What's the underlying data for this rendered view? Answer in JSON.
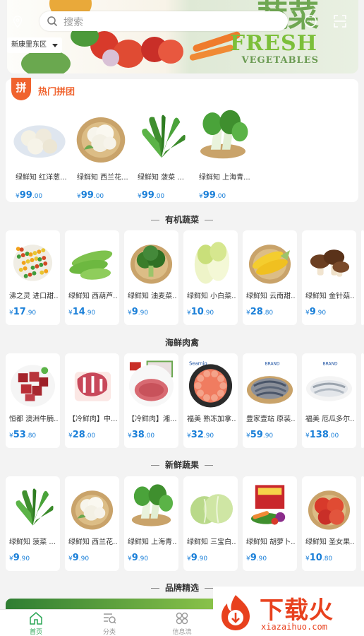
{
  "search": {
    "placeholder": "搜索"
  },
  "location": {
    "district": "新康里东区"
  },
  "banner": {
    "title_cn": "蔬菜",
    "title_en": "FRESH",
    "subtitle_en": "VEGETABLES"
  },
  "group_buy": {
    "badge": "拼",
    "title": "热门拼团",
    "items": [
      {
        "name": "绿鲜知 红洋葱...",
        "sym": "¥",
        "int": "99",
        "dec": ".00",
        "icon": "onion"
      },
      {
        "name": "绿鲜知 西兰花...",
        "sym": "¥",
        "int": "99",
        "dec": ".00",
        "icon": "cauliflower"
      },
      {
        "name": "绿鲜知 菠菜 ...",
        "sym": "¥",
        "int": "99",
        "dec": ".00",
        "icon": "spinach"
      },
      {
        "name": "绿鲜知 上海青...",
        "sym": "¥",
        "int": "99",
        "dec": ".00",
        "icon": "bokchoy"
      }
    ]
  },
  "sections": [
    {
      "title": "有机蔬菜",
      "items": [
        {
          "name": "沸之灵 进口甜...",
          "sym": "¥",
          "int": "17",
          "dec": ".90",
          "icon": "mixed-veg"
        },
        {
          "name": "绿鲜知 西葫芦...",
          "sym": "¥",
          "int": "14",
          "dec": ".90",
          "icon": "zucchini"
        },
        {
          "name": "绿鲜知 油麦菜...",
          "sym": "¥",
          "int": "9",
          "dec": ".90",
          "icon": "broccoli"
        },
        {
          "name": "绿鲜知 小白菜...",
          "sym": "¥",
          "int": "10",
          "dec": ".90",
          "icon": "cabbage"
        },
        {
          "name": "绿鲜知 云南甜...",
          "sym": "¥",
          "int": "28",
          "dec": ".80",
          "icon": "corn"
        },
        {
          "name": "绿鲜知 金针菇...",
          "sym": "¥",
          "int": "9",
          "dec": ".90",
          "icon": "mushroom"
        }
      ]
    },
    {
      "title": "海鲜肉禽",
      "items": [
        {
          "name": "恒都 澳洲牛腩...",
          "sym": "¥",
          "int": "53",
          "dec": ".80",
          "icon": "beef"
        },
        {
          "name": "【冷鲜肉】中...",
          "sym": "¥",
          "int": "28",
          "dec": ".00",
          "icon": "ribs"
        },
        {
          "name": "【冷鲜肉】湘...",
          "sym": "¥",
          "int": "38",
          "dec": ".00",
          "icon": "mince"
        },
        {
          "name": "福美 熟冻加拿...",
          "sym": "¥",
          "int": "32",
          "dec": ".90",
          "icon": "shrimp-plate"
        },
        {
          "name": "豊家壹站 原装...",
          "sym": "¥",
          "int": "59",
          "dec": ".90",
          "icon": "prawns"
        },
        {
          "name": "福美 厄瓜多尔...",
          "sym": "¥",
          "int": "138",
          "dec": ".00",
          "icon": "white-shrimp"
        }
      ]
    },
    {
      "title": "新鲜蔬果",
      "items": [
        {
          "name": "绿鲜知 菠菜 ...",
          "sym": "¥",
          "int": "9",
          "dec": ".90",
          "icon": "spinach"
        },
        {
          "name": "绿鲜知 西兰花...",
          "sym": "¥",
          "int": "9",
          "dec": ".90",
          "icon": "cauliflower"
        },
        {
          "name": "绿鲜知 上海青...",
          "sym": "¥",
          "int": "9",
          "dec": ".90",
          "icon": "bokchoy"
        },
        {
          "name": "绿鲜知 三宝白...",
          "sym": "¥",
          "int": "9",
          "dec": ".90",
          "icon": "lettuce"
        },
        {
          "name": "绿鲜知 胡萝卜...",
          "sym": "¥",
          "int": "9",
          "dec": ".90",
          "icon": "veg-box"
        },
        {
          "name": "绿鲜知 圣女果...",
          "sym": "¥",
          "int": "10",
          "dec": ".80",
          "icon": "tomato"
        }
      ]
    }
  ],
  "brand_section": {
    "title": "品牌精选"
  },
  "tabbar": [
    {
      "label": "首页",
      "icon": "home-icon",
      "active": true
    },
    {
      "label": "分类",
      "icon": "category-icon",
      "active": false
    },
    {
      "label": "信息流",
      "icon": "feed-icon",
      "active": false
    }
  ],
  "watermark": {
    "cn": "下载火",
    "url": "xiazaihuo.com"
  },
  "colors": {
    "accent_green": "#2aa655",
    "price_blue": "#1a7fd8",
    "badge_orange": "#f0632e"
  }
}
